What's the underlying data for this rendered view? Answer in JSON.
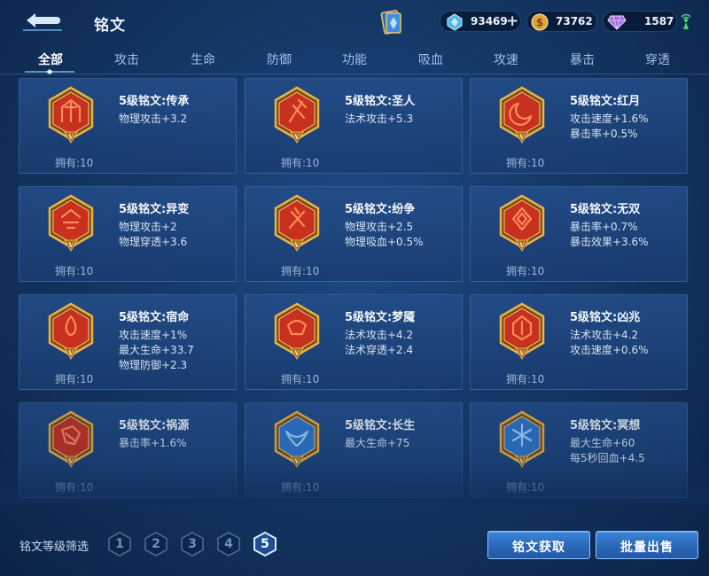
{
  "header": {
    "title": "铭文",
    "currencies": [
      {
        "icon": "diamond-icon",
        "value": "93469",
        "has_plus": true
      },
      {
        "icon": "gold-coin-icon",
        "value": "73762",
        "has_plus": false
      },
      {
        "icon": "purple-crystal-icon",
        "value": "1587",
        "has_plus": false
      }
    ],
    "plus_label": "+"
  },
  "tabs": [
    {
      "label": "全部",
      "active": true
    },
    {
      "label": "攻击",
      "active": false
    },
    {
      "label": "生命",
      "active": false
    },
    {
      "label": "防御",
      "active": false
    },
    {
      "label": "功能",
      "active": false
    },
    {
      "label": "吸血",
      "active": false
    },
    {
      "label": "攻速",
      "active": false
    },
    {
      "label": "暴击",
      "active": false
    },
    {
      "label": "穿透",
      "active": false
    }
  ],
  "runes": [
    {
      "name": "5级铭文:传承",
      "color": "red",
      "attrs": [
        "物理攻击+3.2"
      ],
      "owned": "拥有:10"
    },
    {
      "name": "5级铭文:圣人",
      "color": "red",
      "attrs": [
        "法术攻击+5.3"
      ],
      "owned": "拥有:10"
    },
    {
      "name": "5级铭文:红月",
      "color": "red",
      "attrs": [
        "攻击速度+1.6%",
        "暴击率+0.5%"
      ],
      "owned": "拥有:10"
    },
    {
      "name": "5级铭文:异变",
      "color": "red",
      "attrs": [
        "物理攻击+2",
        "物理穿透+3.6"
      ],
      "owned": "拥有:10"
    },
    {
      "name": "5级铭文:纷争",
      "color": "red",
      "attrs": [
        "物理攻击+2.5",
        "物理吸血+0.5%"
      ],
      "owned": "拥有:10"
    },
    {
      "name": "5级铭文:无双",
      "color": "red",
      "attrs": [
        "暴击率+0.7%",
        "暴击效果+3.6%"
      ],
      "owned": "拥有:10"
    },
    {
      "name": "5级铭文:宿命",
      "color": "red",
      "attrs": [
        "攻击速度+1%",
        "最大生命+33.7",
        "物理防御+2.3"
      ],
      "owned": "拥有:10"
    },
    {
      "name": "5级铭文:梦魇",
      "color": "red",
      "attrs": [
        "法术攻击+4.2",
        "法术穿透+2.4"
      ],
      "owned": "拥有:10"
    },
    {
      "name": "5级铭文:凶兆",
      "color": "red",
      "attrs": [
        "法术攻击+4.2",
        "攻击速度+0.6%"
      ],
      "owned": "拥有:10"
    },
    {
      "name": "5级铭文:祸源",
      "color": "red",
      "attrs": [
        "暴击率+1.6%"
      ],
      "owned": "拥有:10"
    },
    {
      "name": "5级铭文:长生",
      "color": "blue",
      "attrs": [
        "最大生命+75"
      ],
      "owned": "拥有:10"
    },
    {
      "name": "5级铭文:冥想",
      "color": "blue",
      "attrs": [
        "最大生命+60",
        "每5秒回血+4.5"
      ],
      "owned": "拥有:10"
    }
  ],
  "rune_level_mark": "V",
  "bottom": {
    "filter_label": "铭文等级筛选",
    "levels": [
      {
        "label": "1",
        "active": false
      },
      {
        "label": "2",
        "active": false
      },
      {
        "label": "3",
        "active": false
      },
      {
        "label": "4",
        "active": false
      },
      {
        "label": "5",
        "active": true
      }
    ],
    "acquire_button": "铭文获取",
    "bulk_sell_button": "批量出售"
  },
  "colors": {
    "rune_red": "#c8311f",
    "rune_blue": "#2f74c8",
    "rune_gold": "#e8b14a",
    "button_blue": "#2a67b8"
  }
}
